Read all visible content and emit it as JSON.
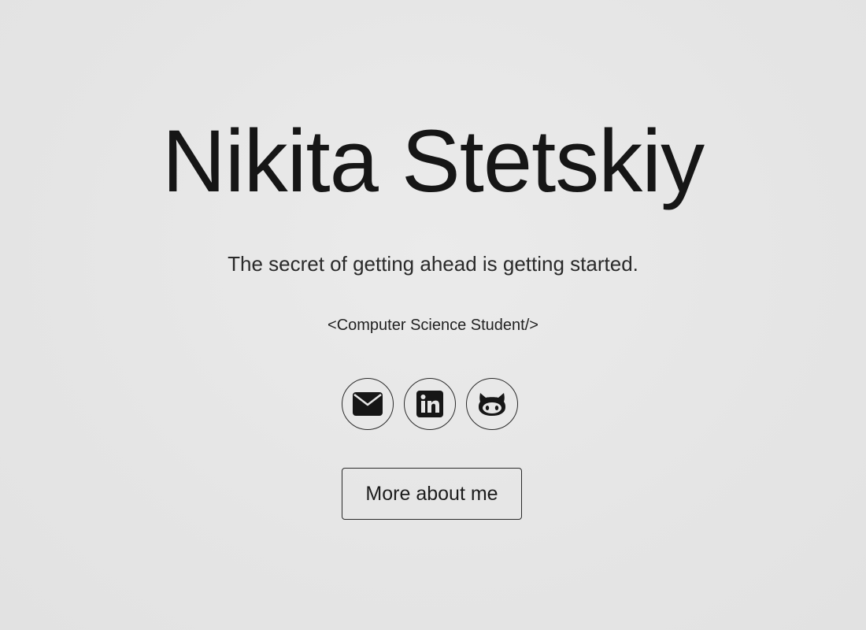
{
  "hero": {
    "name": "Nikita Stetskiy",
    "tagline": "The secret of getting ahead is getting started.",
    "role": "<Computer Science Student/>"
  },
  "socials": [
    {
      "icon": "email-icon"
    },
    {
      "icon": "linkedin-icon"
    },
    {
      "icon": "github-icon"
    }
  ],
  "cta": {
    "label": "More about me"
  },
  "colors": {
    "background": "#e6e6e6",
    "text": "#1a1a1a",
    "border": "#2a2a2a"
  }
}
